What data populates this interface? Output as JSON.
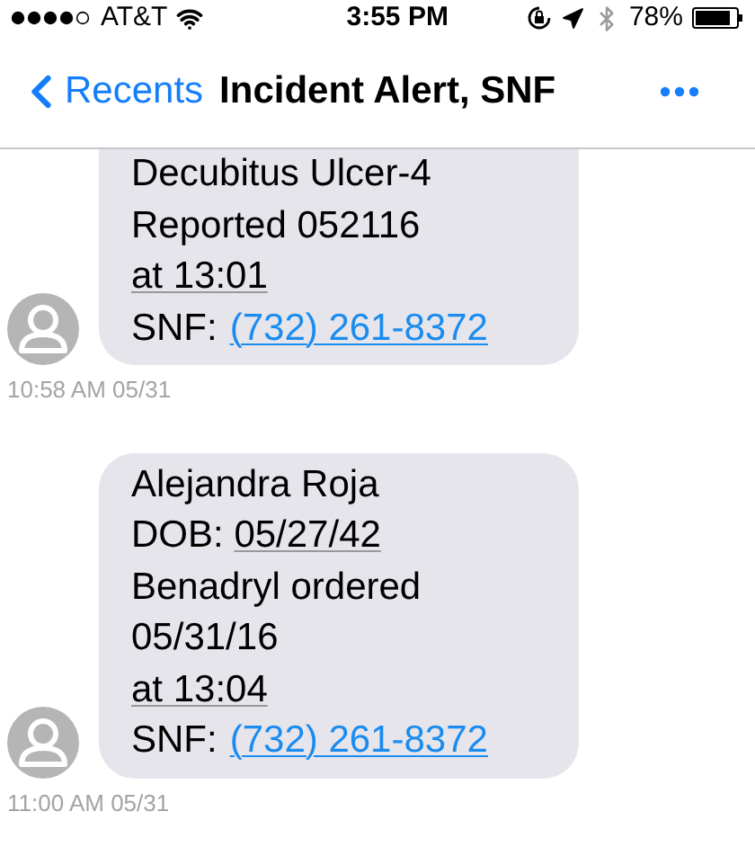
{
  "status_bar": {
    "carrier": "AT&T",
    "time": "3:55 PM",
    "battery": "78%"
  },
  "nav": {
    "back": "Recents",
    "title": "Incident Alert, SNF"
  },
  "messages": [
    {
      "cut_top": true,
      "lines": [
        {
          "kind": "plain",
          "text": "Decubitus Ulcer-4"
        },
        {
          "kind": "plain",
          "text": "Reported 052116"
        },
        {
          "kind": "detected",
          "text": "at 13:01"
        },
        {
          "kind": "phone",
          "label": "SNF:",
          "link": "(732) 261-8372"
        }
      ],
      "timestamp": "10:58 AM 05/31"
    },
    {
      "cut_top": false,
      "lines": [
        {
          "kind": "plain",
          "text": "Alejandra Roja"
        },
        {
          "kind": "field",
          "label": "DOB:",
          "value": "05/27/42"
        },
        {
          "kind": "plain",
          "text": "Benadryl ordered"
        },
        {
          "kind": "plain",
          "text": "05/31/16"
        },
        {
          "kind": "detected",
          "text": "at 13:04"
        },
        {
          "kind": "phone",
          "label": "SNF:",
          "link": "(732) 261-8372"
        }
      ],
      "timestamp": "11:00 AM 05/31"
    }
  ]
}
